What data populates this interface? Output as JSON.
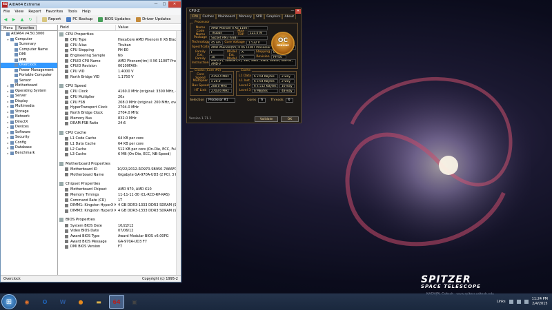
{
  "aida": {
    "title": "AIDA64 Extreme",
    "menus": [
      "File",
      "View",
      "Report",
      "Favorites",
      "Tools",
      "Help"
    ],
    "toolbar": {
      "report": "Report",
      "pc_backup": "PC Backup",
      "bios_updates": "BIOS Updates",
      "driver_updates": "Driver Updates"
    },
    "tabs": [
      "Menu",
      "Favorites"
    ],
    "tree": [
      {
        "label": "AIDA64 v4.50.3000",
        "level": 0,
        "exp": ""
      },
      {
        "label": "Computer",
        "level": 1,
        "exp": "▾"
      },
      {
        "label": "Summary",
        "level": 2,
        "exp": ""
      },
      {
        "label": "Computer Name",
        "level": 2,
        "exp": ""
      },
      {
        "label": "DMI",
        "level": 2,
        "exp": ""
      },
      {
        "label": "IPMI",
        "level": 2,
        "exp": ""
      },
      {
        "label": "Overclock",
        "level": 2,
        "exp": "",
        "selected": true
      },
      {
        "label": "Power Management",
        "level": 2,
        "exp": ""
      },
      {
        "label": "Portable Computer",
        "level": 2,
        "exp": ""
      },
      {
        "label": "Sensor",
        "level": 2,
        "exp": ""
      },
      {
        "label": "Motherboard",
        "level": 1,
        "exp": "▸"
      },
      {
        "label": "Operating System",
        "level": 1,
        "exp": "▸"
      },
      {
        "label": "Server",
        "level": 1,
        "exp": "▸"
      },
      {
        "label": "Display",
        "level": 1,
        "exp": "▸"
      },
      {
        "label": "Multimedia",
        "level": 1,
        "exp": "▸"
      },
      {
        "label": "Storage",
        "level": 1,
        "exp": "▸"
      },
      {
        "label": "Network",
        "level": 1,
        "exp": "▸"
      },
      {
        "label": "DirectX",
        "level": 1,
        "exp": "▸"
      },
      {
        "label": "Devices",
        "level": 1,
        "exp": "▸"
      },
      {
        "label": "Software",
        "level": 1,
        "exp": "▸"
      },
      {
        "label": "Security",
        "level": 1,
        "exp": "▸"
      },
      {
        "label": "Config",
        "level": 1,
        "exp": "▸"
      },
      {
        "label": "Database",
        "level": 1,
        "exp": "▸"
      },
      {
        "label": "Benchmark",
        "level": 1,
        "exp": "▸"
      }
    ],
    "columns": {
      "field": "Field",
      "value": "Value"
    },
    "sections": [
      {
        "title": "CPU Properties",
        "rows": [
          [
            "CPU Type",
            "HexaCore AMD Phenom II X6 Black"
          ],
          [
            "CPU Alias",
            "Thuban"
          ],
          [
            "CPU Stepping",
            "PH-E0"
          ],
          [
            "Engineering Sample",
            "No"
          ],
          [
            "CPUID CPU Name",
            "AMD Phenom(tm) II X6 1100T Proce"
          ],
          [
            "CPUID Revision",
            "00100FA0h"
          ],
          [
            "CPU VID",
            "1.4000 V"
          ],
          [
            "North Bridge VID",
            "1.1750 V"
          ]
        ]
      },
      {
        "title": "CPU Speed",
        "rows": [
          [
            "CPU Clock",
            "4160.0 MHz  (original: 3300 MHz, ov"
          ],
          [
            "CPU Multiplier",
            "20x"
          ],
          [
            "CPU FSB",
            "208.0 MHz  (original: 200 MHz, over"
          ],
          [
            "HyperTransport Clock",
            "2704.0 MHz"
          ],
          [
            "North Bridge Clock",
            "2704.0 MHz"
          ],
          [
            "Memory Bus",
            "832.0 MHz"
          ],
          [
            "DRAM:FSB Ratio",
            "24:6"
          ]
        ]
      },
      {
        "title": "CPU Cache",
        "rows": [
          [
            "L1 Code Cache",
            "64 KB per core"
          ],
          [
            "L1 Data Cache",
            "64 KB per core"
          ],
          [
            "L2 Cache",
            "512 KB per core  (On-Die, ECC, Full-"
          ],
          [
            "L3 Cache",
            "6 MB  (On-Die, ECC, NB-Speed)"
          ]
        ]
      },
      {
        "title": "Motherboard Properties",
        "rows": [
          [
            "Motherboard ID",
            "10/22/2012-RD970-SB950-7A66F0D5"
          ],
          [
            "Motherboard Name",
            "Gigabyte GA-970A-UD3  (2 PCI, 3 PC"
          ]
        ]
      },
      {
        "title": "Chipset Properties",
        "rows": [
          [
            "Motherboard Chipset",
            "AMD 970, AMD K10"
          ],
          [
            "Memory Timings",
            "11-11-11-30  (CL-RCD-RP-RAS)"
          ],
          [
            "Command Rate (CR)",
            "1T"
          ],
          [
            "DIMM1: Kingston HyperX K...",
            "4 GB DDR3-1333 DDR3 SDRAM  (9-9"
          ],
          [
            "DIMM3: Kingston HyperX K...",
            "4 GB DDR3-1333 DDR3 SDRAM  (9-9"
          ]
        ]
      },
      {
        "title": "BIOS Properties",
        "rows": [
          [
            "System BIOS Date",
            "10/22/12"
          ],
          [
            "Video BIOS Date",
            "07/06/12"
          ],
          [
            "Award BIOS Type",
            "Award Modular BIOS v6.00PG"
          ],
          [
            "Award BIOS Message",
            "GA-970A-UD3 F7"
          ],
          [
            "DMI BIOS Version",
            "F7"
          ]
        ]
      }
    ],
    "status_left": "Overclock",
    "status_right": "Copyright (c) 1995-2"
  },
  "cpuz": {
    "title": "CPU-Z",
    "tabs": [
      "CPU",
      "Caches",
      "Mainboard",
      "Memory",
      "SPD",
      "Graphics",
      "About"
    ],
    "processor_legend": "Processor",
    "name_label": "Name",
    "name": "AMD Phenom II X6 1100T",
    "codename_label": "Code Name",
    "codename": "Thuban",
    "maxtdp_label": "Max TDP",
    "maxtdp": "125.0 W",
    "package_label": "Package",
    "package": "Socket AM3 (938)",
    "tech_label": "Technology",
    "tech": "45 nm",
    "corevolt_label": "Core Voltage",
    "corevolt": "1.532 V",
    "spec_label": "Specification",
    "spec": "AMD Phenom(tm) II X6 1100T Processor",
    "family_label": "Family",
    "family": "F",
    "model_label": "Model",
    "model": "A",
    "stepping_label": "Stepping",
    "stepping": "0",
    "extfamily_label": "Ext. Family",
    "extfamily": "10",
    "extmodel_label": "Ext. Model",
    "extmodel": "A",
    "revision_label": "Revision",
    "revision": "PH-E0",
    "instr_label": "Instructions",
    "instr": "MMX(+), 3DNow!(+), SSE, SSE2, SSE3, SSE4A, x86-64, AMD-V",
    "clocks_legend": "Clocks (Core #0)",
    "corespeed_label": "Core Speed",
    "corespeed": "4159.4 MHz",
    "mult_label": "Multiplier",
    "mult": "x 20.0",
    "bus_label": "Bus Speed",
    "bus": "208.0 MHz",
    "ht_label": "HT Link",
    "ht": "2703.6 MHz",
    "cache_legend": "Cache",
    "l1d_label": "L1 Data",
    "l1d": "6 x 64 KBytes",
    "l1d_way": "2-way",
    "l1i_label": "L1 Inst.",
    "l1i": "6 x 64 KBytes",
    "l1i_way": "2-way",
    "l2_label": "Level 2",
    "l2": "6 x 512 KBytes",
    "l2_way": "16-way",
    "l3_label": "Level 3",
    "l3": "6 MBytes",
    "l3_way": "48-way",
    "selection_label": "Selection",
    "selection": "Processor #1",
    "cores_label": "Cores",
    "cores": "6",
    "threads_label": "Threads",
    "threads": "6",
    "version": "Version 1.71.1",
    "validate": "Validate",
    "ok": "OK",
    "logo_text": "OC",
    "logo_sub": "GENUINE"
  },
  "wallpaper": {
    "title": "SPITZER",
    "subtitle": "SPACE TELESCOPE",
    "credit": "NASA/JPL-Caltech · www.spitzer.caltech.edu"
  },
  "taskbar": {
    "apps": [
      {
        "name": "firefox",
        "glyph": "◉",
        "color": "#e8742a"
      },
      {
        "name": "outlook",
        "glyph": "O",
        "color": "#1e62b5"
      },
      {
        "name": "word",
        "glyph": "W",
        "color": "#2b5797"
      },
      {
        "name": "media",
        "glyph": "●",
        "color": "#e68a1e"
      },
      {
        "name": "explorer",
        "glyph": "▬",
        "color": "#d8b04b"
      },
      {
        "name": "aida64",
        "glyph": "64",
        "color": "#b02222",
        "active": true
      },
      {
        "name": "cpuz",
        "glyph": "▣",
        "color": "#444"
      }
    ],
    "links": "Links",
    "time": "11:24 PM",
    "date": "2/4/2015"
  }
}
